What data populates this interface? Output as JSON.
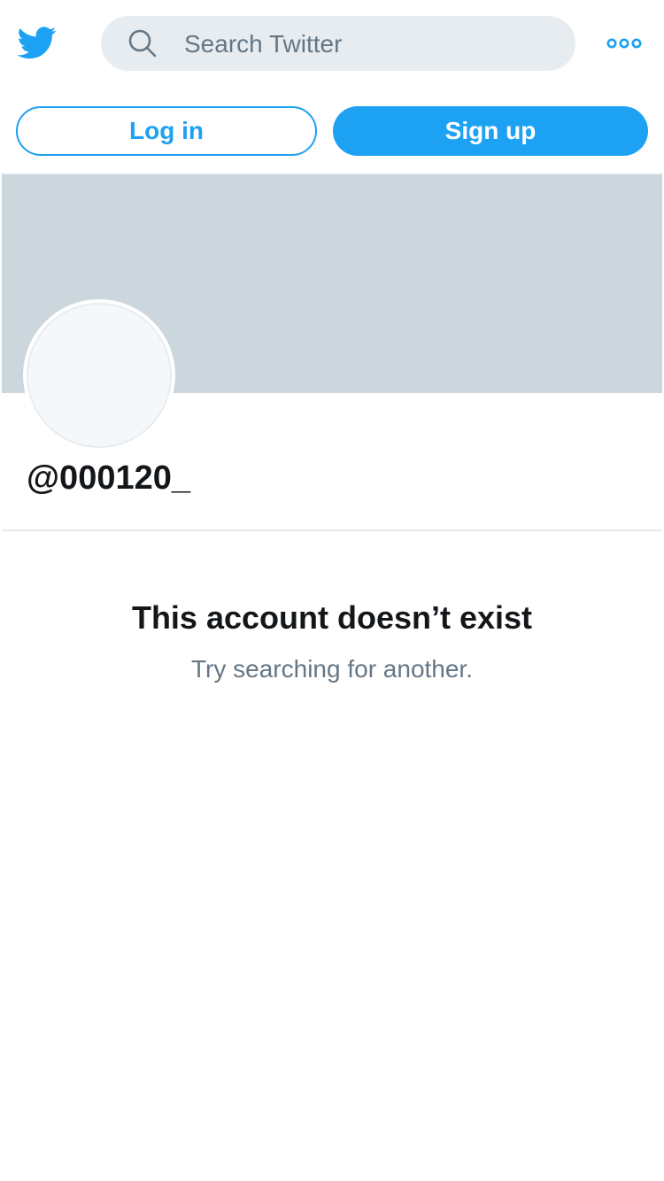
{
  "header": {
    "logo_icon": "twitter-bird-icon",
    "search_placeholder": "Search Twitter",
    "search_icon": "search-icon",
    "more_icon": "more-dots-icon"
  },
  "auth": {
    "login_label": "Log in",
    "signup_label": "Sign up"
  },
  "profile": {
    "handle": "@000120_"
  },
  "empty_state": {
    "title": "This account doesn’t exist",
    "subtitle": "Try searching for another."
  },
  "colors": {
    "accent": "#1da1f2",
    "banner": "#ccd6dd",
    "search_bg": "#e6ecf0",
    "primary_text": "#14171a",
    "secondary_text": "#657786"
  }
}
